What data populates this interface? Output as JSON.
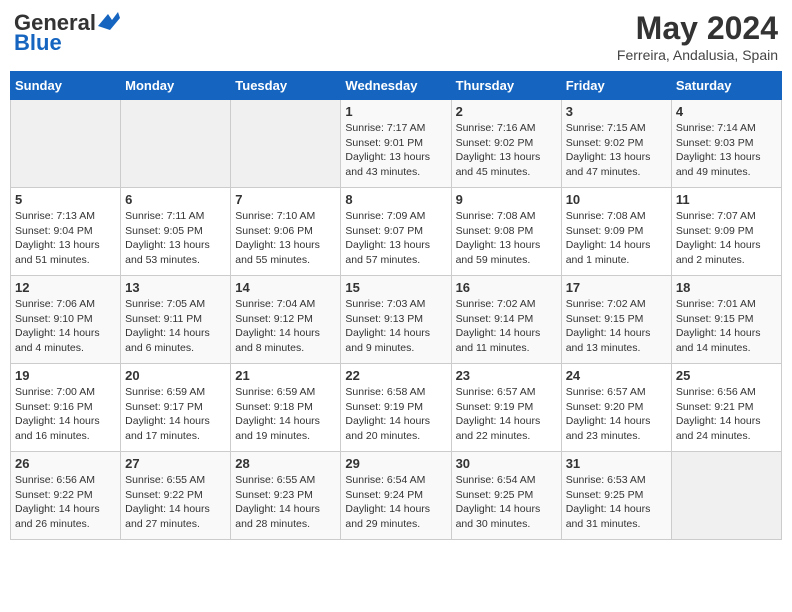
{
  "header": {
    "logo_general": "General",
    "logo_blue": "Blue",
    "month_year": "May 2024",
    "location": "Ferreira, Andalusia, Spain"
  },
  "days_of_week": [
    "Sunday",
    "Monday",
    "Tuesday",
    "Wednesday",
    "Thursday",
    "Friday",
    "Saturday"
  ],
  "weeks": [
    [
      {
        "day": "",
        "info": ""
      },
      {
        "day": "",
        "info": ""
      },
      {
        "day": "",
        "info": ""
      },
      {
        "day": "1",
        "info": "Sunrise: 7:17 AM\nSunset: 9:01 PM\nDaylight: 13 hours\nand 43 minutes."
      },
      {
        "day": "2",
        "info": "Sunrise: 7:16 AM\nSunset: 9:02 PM\nDaylight: 13 hours\nand 45 minutes."
      },
      {
        "day": "3",
        "info": "Sunrise: 7:15 AM\nSunset: 9:02 PM\nDaylight: 13 hours\nand 47 minutes."
      },
      {
        "day": "4",
        "info": "Sunrise: 7:14 AM\nSunset: 9:03 PM\nDaylight: 13 hours\nand 49 minutes."
      }
    ],
    [
      {
        "day": "5",
        "info": "Sunrise: 7:13 AM\nSunset: 9:04 PM\nDaylight: 13 hours\nand 51 minutes."
      },
      {
        "day": "6",
        "info": "Sunrise: 7:11 AM\nSunset: 9:05 PM\nDaylight: 13 hours\nand 53 minutes."
      },
      {
        "day": "7",
        "info": "Sunrise: 7:10 AM\nSunset: 9:06 PM\nDaylight: 13 hours\nand 55 minutes."
      },
      {
        "day": "8",
        "info": "Sunrise: 7:09 AM\nSunset: 9:07 PM\nDaylight: 13 hours\nand 57 minutes."
      },
      {
        "day": "9",
        "info": "Sunrise: 7:08 AM\nSunset: 9:08 PM\nDaylight: 13 hours\nand 59 minutes."
      },
      {
        "day": "10",
        "info": "Sunrise: 7:08 AM\nSunset: 9:09 PM\nDaylight: 14 hours\nand 1 minute."
      },
      {
        "day": "11",
        "info": "Sunrise: 7:07 AM\nSunset: 9:09 PM\nDaylight: 14 hours\nand 2 minutes."
      }
    ],
    [
      {
        "day": "12",
        "info": "Sunrise: 7:06 AM\nSunset: 9:10 PM\nDaylight: 14 hours\nand 4 minutes."
      },
      {
        "day": "13",
        "info": "Sunrise: 7:05 AM\nSunset: 9:11 PM\nDaylight: 14 hours\nand 6 minutes."
      },
      {
        "day": "14",
        "info": "Sunrise: 7:04 AM\nSunset: 9:12 PM\nDaylight: 14 hours\nand 8 minutes."
      },
      {
        "day": "15",
        "info": "Sunrise: 7:03 AM\nSunset: 9:13 PM\nDaylight: 14 hours\nand 9 minutes."
      },
      {
        "day": "16",
        "info": "Sunrise: 7:02 AM\nSunset: 9:14 PM\nDaylight: 14 hours\nand 11 minutes."
      },
      {
        "day": "17",
        "info": "Sunrise: 7:02 AM\nSunset: 9:15 PM\nDaylight: 14 hours\nand 13 minutes."
      },
      {
        "day": "18",
        "info": "Sunrise: 7:01 AM\nSunset: 9:15 PM\nDaylight: 14 hours\nand 14 minutes."
      }
    ],
    [
      {
        "day": "19",
        "info": "Sunrise: 7:00 AM\nSunset: 9:16 PM\nDaylight: 14 hours\nand 16 minutes."
      },
      {
        "day": "20",
        "info": "Sunrise: 6:59 AM\nSunset: 9:17 PM\nDaylight: 14 hours\nand 17 minutes."
      },
      {
        "day": "21",
        "info": "Sunrise: 6:59 AM\nSunset: 9:18 PM\nDaylight: 14 hours\nand 19 minutes."
      },
      {
        "day": "22",
        "info": "Sunrise: 6:58 AM\nSunset: 9:19 PM\nDaylight: 14 hours\nand 20 minutes."
      },
      {
        "day": "23",
        "info": "Sunrise: 6:57 AM\nSunset: 9:19 PM\nDaylight: 14 hours\nand 22 minutes."
      },
      {
        "day": "24",
        "info": "Sunrise: 6:57 AM\nSunset: 9:20 PM\nDaylight: 14 hours\nand 23 minutes."
      },
      {
        "day": "25",
        "info": "Sunrise: 6:56 AM\nSunset: 9:21 PM\nDaylight: 14 hours\nand 24 minutes."
      }
    ],
    [
      {
        "day": "26",
        "info": "Sunrise: 6:56 AM\nSunset: 9:22 PM\nDaylight: 14 hours\nand 26 minutes."
      },
      {
        "day": "27",
        "info": "Sunrise: 6:55 AM\nSunset: 9:22 PM\nDaylight: 14 hours\nand 27 minutes."
      },
      {
        "day": "28",
        "info": "Sunrise: 6:55 AM\nSunset: 9:23 PM\nDaylight: 14 hours\nand 28 minutes."
      },
      {
        "day": "29",
        "info": "Sunrise: 6:54 AM\nSunset: 9:24 PM\nDaylight: 14 hours\nand 29 minutes."
      },
      {
        "day": "30",
        "info": "Sunrise: 6:54 AM\nSunset: 9:25 PM\nDaylight: 14 hours\nand 30 minutes."
      },
      {
        "day": "31",
        "info": "Sunrise: 6:53 AM\nSunset: 9:25 PM\nDaylight: 14 hours\nand 31 minutes."
      },
      {
        "day": "",
        "info": ""
      }
    ]
  ]
}
